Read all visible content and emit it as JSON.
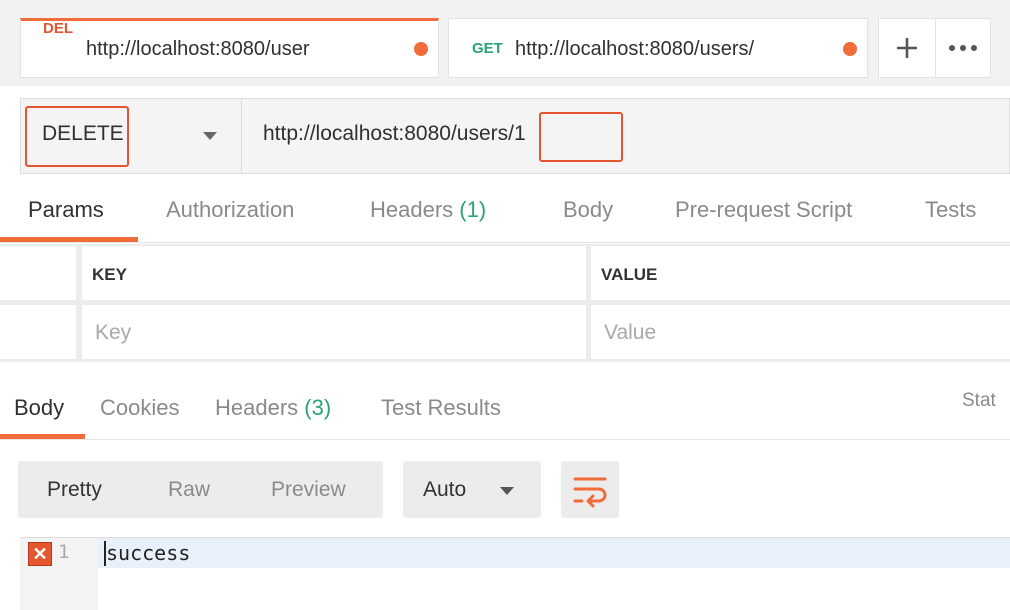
{
  "tabs": [
    {
      "method": "DEL",
      "url": "http://localhost:8080/user",
      "method_color": "#e4572e"
    },
    {
      "method": "GET",
      "url": "http://localhost:8080/users/",
      "method_color": "#2aa37a"
    }
  ],
  "tab_actions": {
    "new_tab": "+",
    "more": "•••"
  },
  "request": {
    "method": "DELETE",
    "url": "http://localhost:8080/users/1"
  },
  "request_tabs": {
    "params": "Params",
    "authorization": "Authorization",
    "headers": "Headers",
    "headers_count": "(1)",
    "body": "Body",
    "prerequest": "Pre-request Script",
    "tests": "Tests"
  },
  "params_table": {
    "key_header": "KEY",
    "value_header": "VALUE",
    "key_placeholder": "Key",
    "value_placeholder": "Value"
  },
  "response_tabs": {
    "body": "Body",
    "cookies": "Cookies",
    "headers": "Headers",
    "headers_count": "(3)",
    "test_results": "Test Results",
    "status": "Stat"
  },
  "response_view": {
    "pretty": "Pretty",
    "raw": "Raw",
    "preview": "Preview",
    "format": "Auto"
  },
  "response_body": {
    "line_number": "1",
    "line_text": "success",
    "error_mark": "✕"
  },
  "colors": {
    "accent": "#f26b3a",
    "highlight_box": "#e4572e",
    "count_green": "#2aa37a"
  }
}
